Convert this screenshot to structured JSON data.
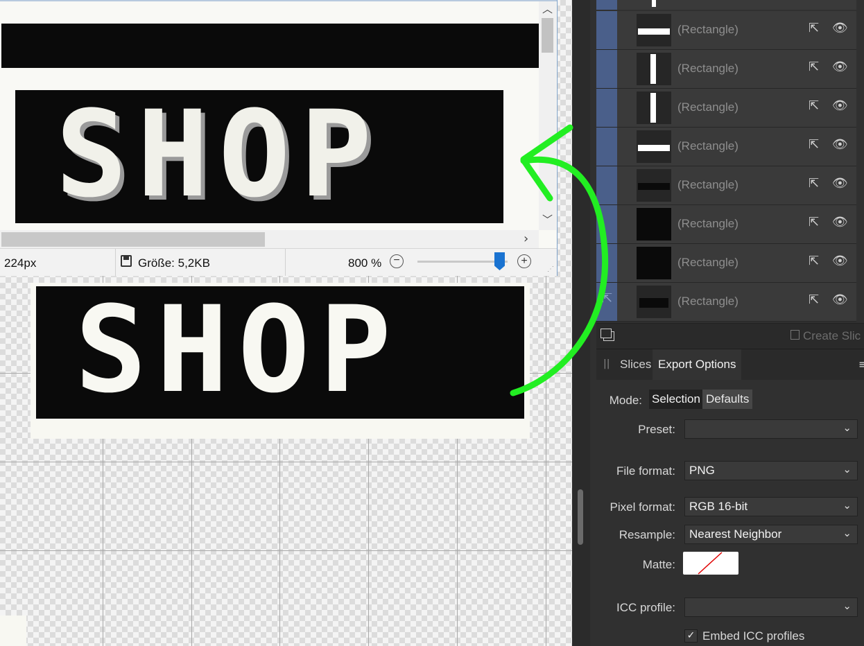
{
  "preview": {
    "dimension_text": "224px",
    "size_text": "Größe: 5,2KB",
    "zoom": "800 %",
    "zoom_out_icon": "minus-circle-icon",
    "zoom_in_icon": "plus-circle-icon",
    "slider_level": 0.9,
    "artwork_text": "SHOP"
  },
  "canvas": {
    "artwork_text": "SHOP"
  },
  "layers": [
    {
      "name": "(Rectangle)",
      "thumb": "horizontal-bar"
    },
    {
      "name": "(Rectangle)",
      "thumb": "vertical-bar"
    },
    {
      "name": "(Rectangle)",
      "thumb": "vertical-bar"
    },
    {
      "name": "(Rectangle)",
      "thumb": "horizontal-bar"
    },
    {
      "name": "(Rectangle)",
      "thumb": "dark-bar"
    },
    {
      "name": "(Rectangle)",
      "thumb": "black"
    },
    {
      "name": "(Rectangle)",
      "thumb": "black"
    },
    {
      "name": "(Rectangle)",
      "thumb": "dark-bar"
    }
  ],
  "slices": {
    "create_slice_label": "Create Slic"
  },
  "tabs": {
    "slices": "Slices",
    "export_options": "Export Options"
  },
  "export": {
    "mode_label": "Mode:",
    "mode_selection": "Selection",
    "mode_defaults": "Defaults",
    "preset_label": "Preset:",
    "preset_value": "",
    "file_format_label": "File format:",
    "file_format_value": "PNG",
    "pixel_format_label": "Pixel format:",
    "pixel_format_value": "RGB 16-bit",
    "resample_label": "Resample:",
    "resample_value": "Nearest Neighbor",
    "matte_label": "Matte:",
    "icc_label": "ICC profile:",
    "icc_value": "",
    "embed_icc_label": "Embed ICC profiles",
    "embed_icc_checked": true
  },
  "colors": {
    "accent_blue": "#4a5f8a",
    "annotation_green": "#22ee22",
    "slider_thumb": "#1a73d1"
  }
}
